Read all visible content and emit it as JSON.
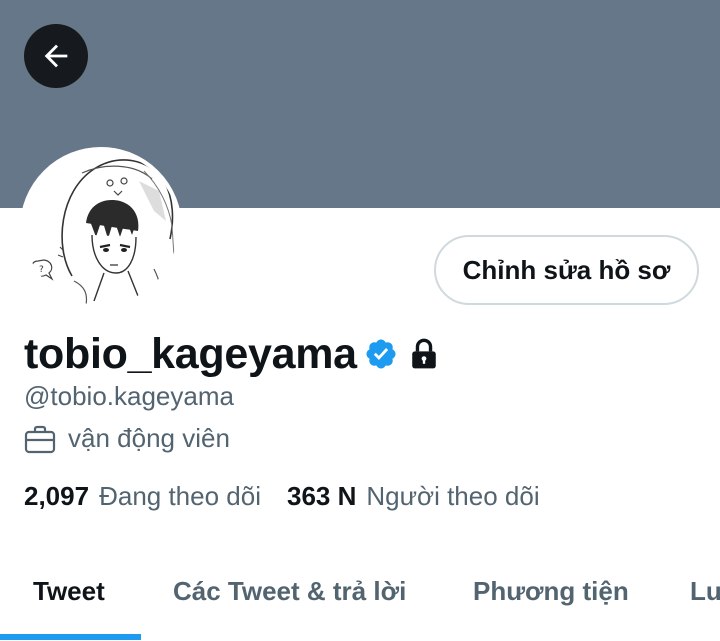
{
  "profile": {
    "display_name": "tobio_kageyama",
    "handle": "@tobio.kageyama",
    "bio": "vận động viên",
    "verified": true,
    "protected": true
  },
  "actions": {
    "edit_profile_label": "Chỉnh sửa hồ sơ"
  },
  "stats": {
    "following_count": "2,097",
    "following_label": "Đang theo dõi",
    "followers_count": "363 N",
    "followers_label": "Người theo dõi"
  },
  "tabs": [
    {
      "label": "Tweet",
      "active": true
    },
    {
      "label": "Các Tweet & trả lời",
      "active": false
    },
    {
      "label": "Phương tiện",
      "active": false
    },
    {
      "label": "Lu",
      "active": false
    }
  ],
  "icons": {
    "back": "arrow-left-icon",
    "verified": "verified-badge-icon",
    "lock": "lock-icon",
    "bio": "briefcase-icon"
  },
  "colors": {
    "banner": "#66778a",
    "accent": "#1d9bf0",
    "text_primary": "#0f1419",
    "text_secondary": "#536471",
    "button_border": "#cfd9de"
  }
}
